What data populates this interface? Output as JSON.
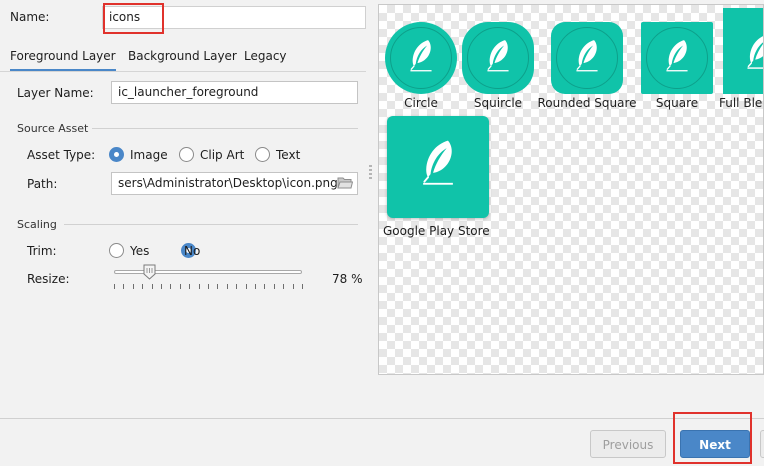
{
  "form": {
    "name_label": "Name:",
    "name_value": "icons",
    "tabs": [
      {
        "label": "Foreground Layer",
        "active": true
      },
      {
        "label": "Background Layer",
        "active": false
      },
      {
        "label": "Legacy",
        "active": false
      }
    ],
    "layer_name_label": "Layer Name:",
    "layer_name_value": "ic_launcher_foreground",
    "source_asset_title": "Source Asset",
    "asset_type_label": "Asset Type:",
    "asset_type_options": [
      "Image",
      "Clip Art",
      "Text"
    ],
    "asset_type_selected": "Image",
    "path_label": "Path:",
    "path_value": "sers\\Administrator\\Desktop\\icon.png",
    "scaling_title": "Scaling",
    "trim_label": "Trim:",
    "trim_options": [
      "Yes",
      "No"
    ],
    "trim_selected": "No",
    "resize_label": "Resize:",
    "resize_value_text": "78 %",
    "resize_fraction": 0.19
  },
  "preview": {
    "icon_color": "#10c3a9",
    "icons": [
      "Circle",
      "Squircle",
      "Rounded Square",
      "Square",
      "Full Bleed Layers",
      "Google Play Store"
    ]
  },
  "footer": {
    "previous_label": "Previous",
    "next_label": "Next"
  },
  "colors": {
    "accent": "#4a87c8",
    "highlight": "#e0322c",
    "icon_bg": "#10c3a9"
  }
}
